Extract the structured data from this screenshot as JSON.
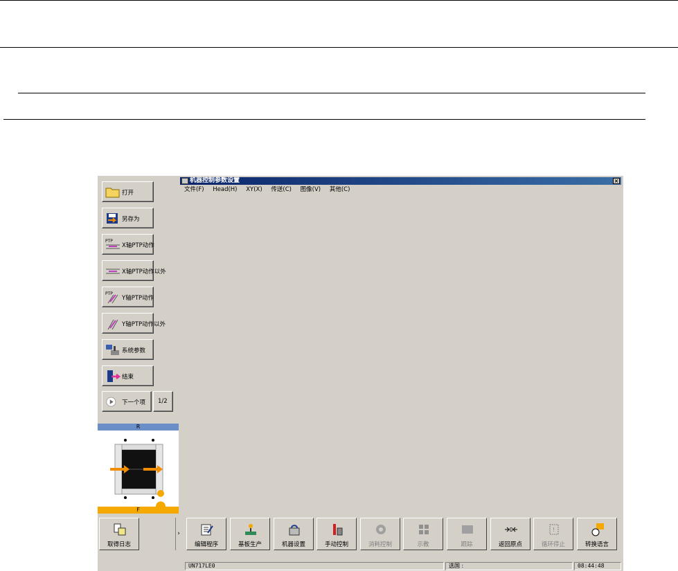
{
  "window": {
    "title": "机器控制参数设置",
    "menu": [
      "文件(F)",
      "Head(H)",
      "XY(X)",
      "传送(C)",
      "图像(V)",
      "其他(C)"
    ]
  },
  "sidebar": {
    "buttons": [
      {
        "label": "打开",
        "icon": "folder-icon"
      },
      {
        "label": "另存为",
        "icon": "save-as-icon"
      },
      {
        "label": "X轴PTP动作",
        "icon": "x-axis-ptp-icon"
      },
      {
        "label": "X轴PTP动作以外",
        "icon": "x-axis-other-icon"
      },
      {
        "label": "Y轴PTP动作",
        "icon": "y-axis-ptp-icon"
      },
      {
        "label": "Y轴PTP动作以外",
        "icon": "y-axis-other-icon"
      },
      {
        "label": "系统参数",
        "icon": "system-params-icon"
      },
      {
        "label": "结束",
        "icon": "exit-door-icon"
      }
    ],
    "next_label": "下一个项",
    "page_indicator": "1/2"
  },
  "diagram": {
    "top_label": "R",
    "bottom_label": "F"
  },
  "log_button": {
    "label": "取得日志"
  },
  "toolbar": {
    "buttons": [
      {
        "label": "编辑程序",
        "enabled": true
      },
      {
        "label": "基板生产",
        "enabled": true
      },
      {
        "label": "机器设置",
        "enabled": true
      },
      {
        "label": "手动控制",
        "enabled": true
      },
      {
        "label": "消耗控制",
        "enabled": false
      },
      {
        "label": "示教",
        "enabled": false
      },
      {
        "label": "跟踪",
        "enabled": false
      },
      {
        "label": "返回原点",
        "enabled": true
      },
      {
        "label": "循环停止",
        "enabled": false
      },
      {
        "label": "转换语言",
        "enabled": true
      }
    ]
  },
  "statusbar": {
    "machine_id": "UN717LE0",
    "selection_label": "选国 :",
    "time": "08:44:48"
  }
}
